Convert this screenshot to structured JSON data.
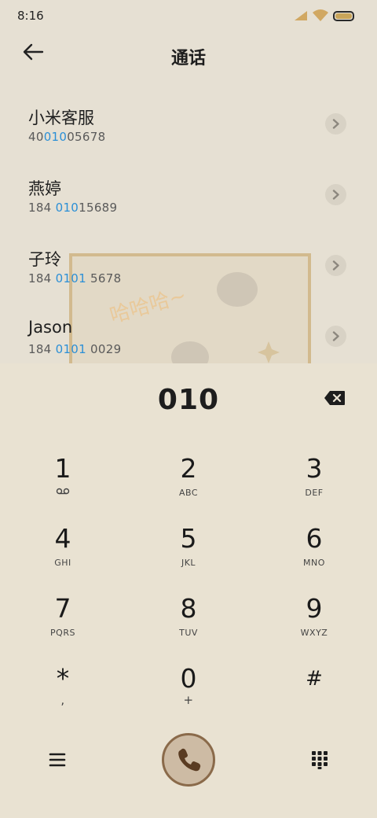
{
  "status": {
    "time": "8:16"
  },
  "header": {
    "title": "通话"
  },
  "contacts": [
    {
      "name": "小米客服",
      "num_pre": "40",
      "num_hl": "010",
      "num_post": "05678"
    },
    {
      "name": "燕婷",
      "num_pre": "184 ",
      "num_hl": "010",
      "num_post": "15689"
    },
    {
      "name": "子玲",
      "num_pre": "184 ",
      "num_hl": "0101",
      "num_post": " 5678"
    },
    {
      "name": "Jason",
      "num_pre": "184 ",
      "num_hl": "0101",
      "num_post": " 0029"
    }
  ],
  "dialpad": {
    "entered": "010",
    "keys": [
      {
        "digit": "1",
        "letters": ""
      },
      {
        "digit": "2",
        "letters": "ABC"
      },
      {
        "digit": "3",
        "letters": "DEF"
      },
      {
        "digit": "4",
        "letters": "GHI"
      },
      {
        "digit": "5",
        "letters": "JKL"
      },
      {
        "digit": "6",
        "letters": "MNO"
      },
      {
        "digit": "7",
        "letters": "PQRS"
      },
      {
        "digit": "8",
        "letters": "TUV"
      },
      {
        "digit": "9",
        "letters": "WXYZ"
      },
      {
        "digit": "*",
        "letters": ","
      },
      {
        "digit": "0",
        "letters": "+"
      },
      {
        "digit": "#",
        "letters": ""
      }
    ]
  },
  "colors": {
    "background": "#e6e0d3",
    "highlight": "#2b8fd6",
    "call_button": "#cdbba4"
  },
  "icons": [
    "back-arrow-icon",
    "chevron-right-icon",
    "backspace-icon",
    "voicemail-icon",
    "menu-icon",
    "phone-icon",
    "dialpad-grid-icon"
  ]
}
